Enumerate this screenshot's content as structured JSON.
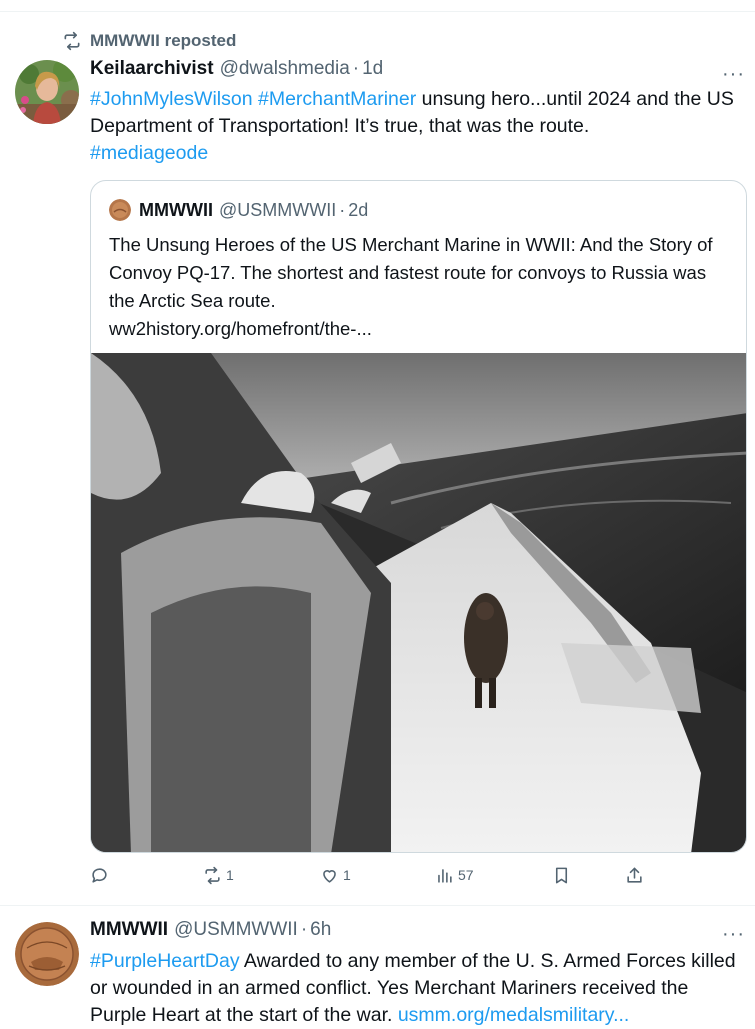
{
  "repost": {
    "label": "MMWWII reposted",
    "icon": "repost-icon"
  },
  "tweet1": {
    "name": "Keilaarchivist",
    "handle": "@dwalshmedia",
    "sep": "·",
    "time": "1d",
    "more": "···",
    "text": {
      "tag1": "#JohnMylesWilson",
      "tag2": "#MerchantMariner",
      "part1": " unsung hero...until 2024 and the US Department of Transportation! It’s true, that was the route.",
      "tag3": "#mediageode"
    },
    "quote": {
      "name": "MMWWII",
      "handle": "@USMMWWII",
      "sep": "·",
      "time": "2d",
      "text": "The Unsung Heroes of the US Merchant Marine in WWII: And the Story of Convoy PQ-17. The shortest and fastest route for convoys to Russia was the Arctic Sea route.",
      "link": "ww2history.org/homefront/the-..."
    },
    "actions": {
      "reply_count": "",
      "repost_count": "1",
      "like_count": "1",
      "views_count": "57"
    }
  },
  "tweet2": {
    "name": "MMWWII",
    "handle": "@USMMWWII",
    "sep": "·",
    "time": "6h",
    "more": "···",
    "tag": "#PurpleHeartDay",
    "text": " Awarded to any member of the U. S. Armed Forces killed or wounded in an armed conflict. Yes Merchant Mariners received the Purple Heart  at the start of the war. ",
    "link": "usmm.org/medalsmilitary..."
  },
  "colors": {
    "accent": "#1d9bf0",
    "secondary_text": "#536471",
    "border": "#cfd9de"
  }
}
